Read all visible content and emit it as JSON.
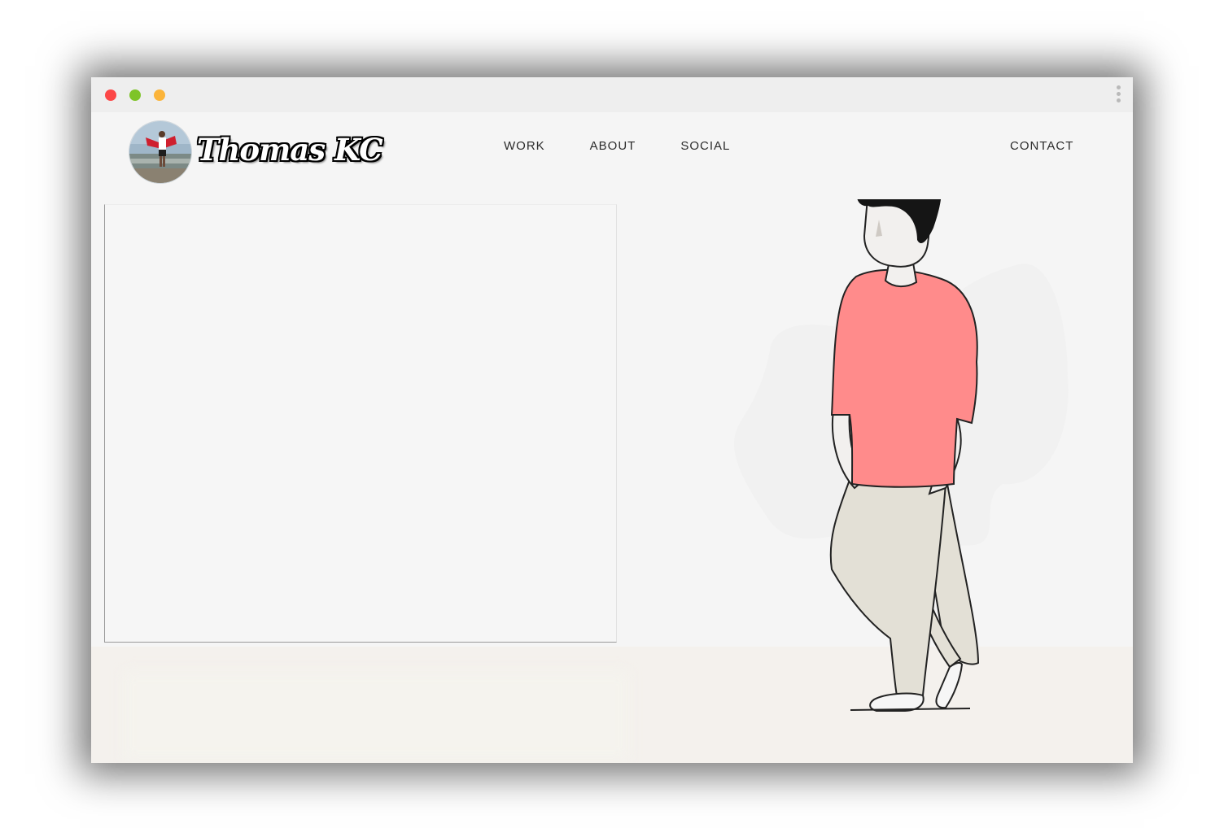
{
  "window": {
    "controls": [
      "close",
      "minimize",
      "maximize"
    ],
    "menu_icon": "kebab-menu-icon"
  },
  "brand": {
    "name": "Thomas KC",
    "avatar_icon": "profile-photo"
  },
  "nav": {
    "links": [
      {
        "label": "WORK"
      },
      {
        "label": "ABOUT"
      },
      {
        "label": "SOCIAL"
      }
    ],
    "contact_label": "CONTACT"
  },
  "colors": {
    "shirt": "#ff8b8b",
    "pants": "#e3e0d6",
    "hair": "#151515",
    "skin": "#f2f0ee",
    "background": "#f5f5f5",
    "floor": "#f4f1ed"
  },
  "illustration": {
    "subject": "standing-man-illustration"
  }
}
